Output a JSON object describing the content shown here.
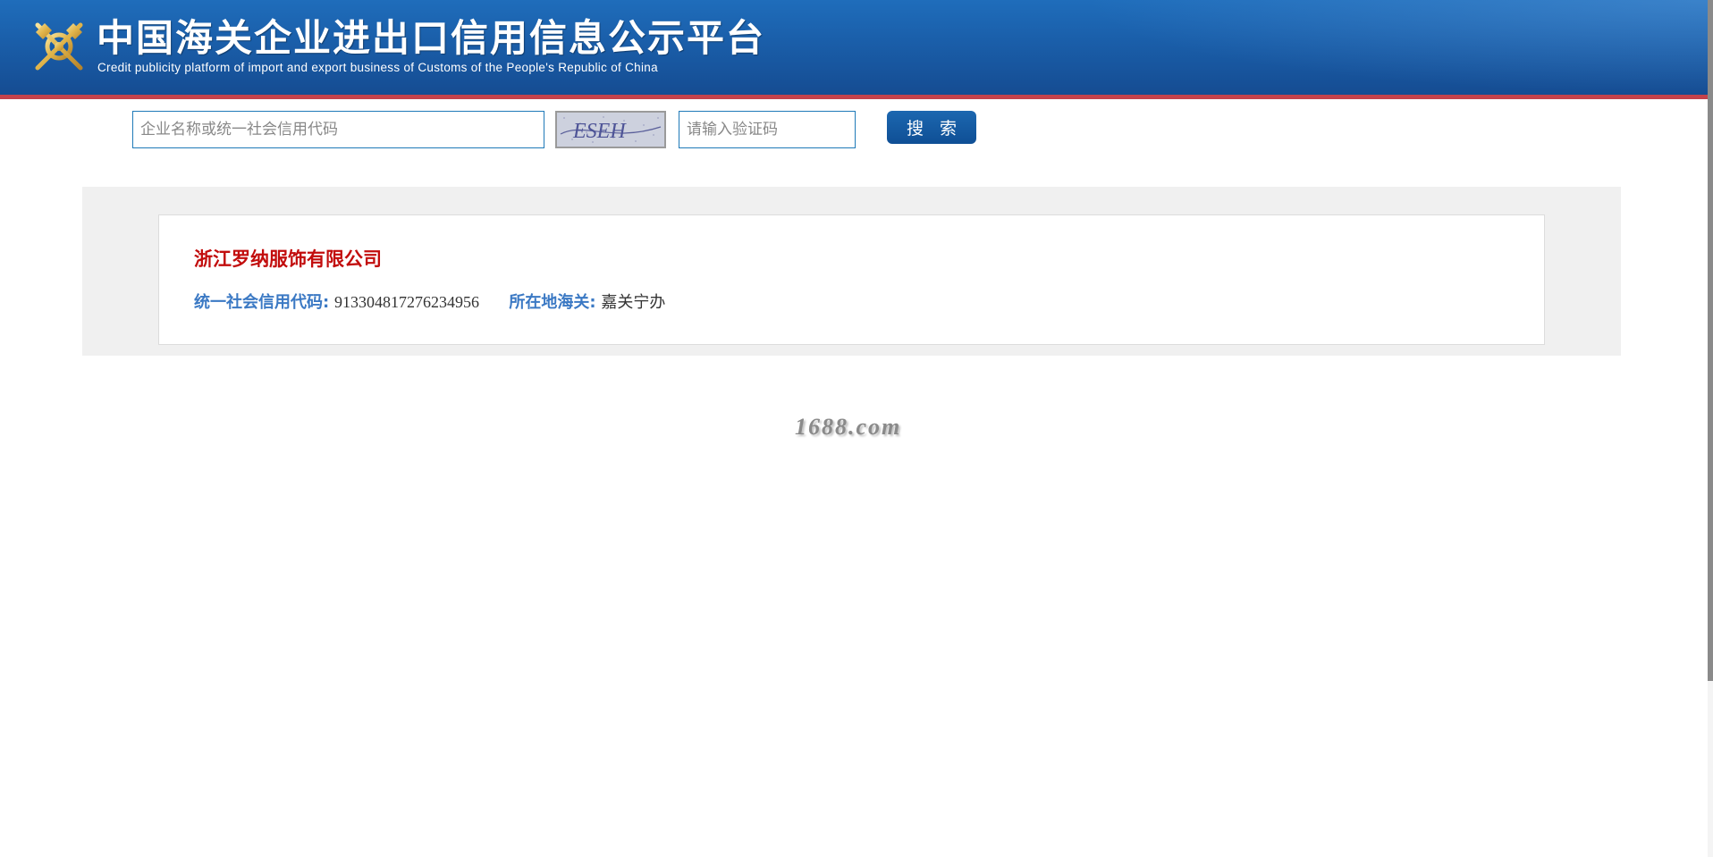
{
  "header": {
    "title": "中国海关企业进出口信用信息公示平台",
    "subtitle": "Credit publicity platform of import and export business of Customs of the People's Republic of China",
    "logo_icon": "customs-emblem-icon",
    "colors": {
      "banner": "#1a5ea9",
      "stripe": "#c4424b"
    }
  },
  "search": {
    "keyword_placeholder": "企业名称或统一社会信用代码",
    "keyword_value": "",
    "captcha_text": "ESEH",
    "captcha_placeholder": "请输入验证码",
    "captcha_value": "",
    "button_label": "搜 索"
  },
  "result": {
    "company_name": "浙江罗纳服饰有限公司",
    "credit_code_label": "统一社会信用代码:",
    "credit_code": "913304817276234956",
    "customs_label": "所在地海关:",
    "customs": "嘉关宁办",
    "colors": {
      "name": "#c20d0d",
      "label": "#3b79c4"
    }
  },
  "watermark": "1688.com"
}
